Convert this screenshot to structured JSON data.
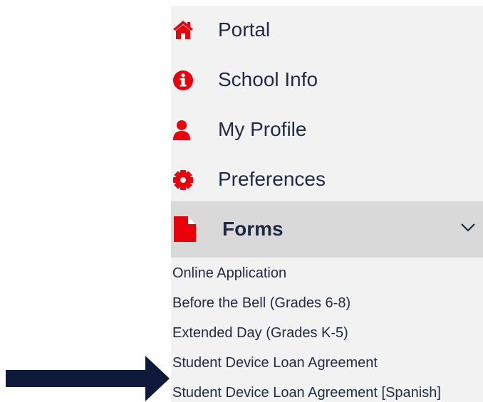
{
  "menu": {
    "items": [
      {
        "label": "Portal",
        "icon": "home-icon"
      },
      {
        "label": "School Info",
        "icon": "info-circle-icon"
      },
      {
        "label": "My Profile",
        "icon": "user-icon"
      },
      {
        "label": "Preferences",
        "icon": "gear-icon"
      }
    ],
    "forms": {
      "label": "Forms",
      "icon": "document-icon",
      "expanded": true,
      "toggle_icon": "chevron-down-icon",
      "sub_items": [
        "Online Application",
        "Before the Bell (Grades 6-8)",
        "Extended Day (Grades K-5)",
        "Student Device Loan Agreement",
        "Student Device Loan Agreement [Spanish]"
      ]
    }
  },
  "annotation": {
    "icon": "arrow-right-icon",
    "points_to": "Student Device Loan Agreement [Spanish]"
  },
  "colors": {
    "icon_red": "#e8000b",
    "text_navy": "#1f2a44",
    "panel_bg": "#f2f2f2",
    "active_row_bg": "#d9d9d9",
    "arrow_fill": "#0f1a3a"
  }
}
